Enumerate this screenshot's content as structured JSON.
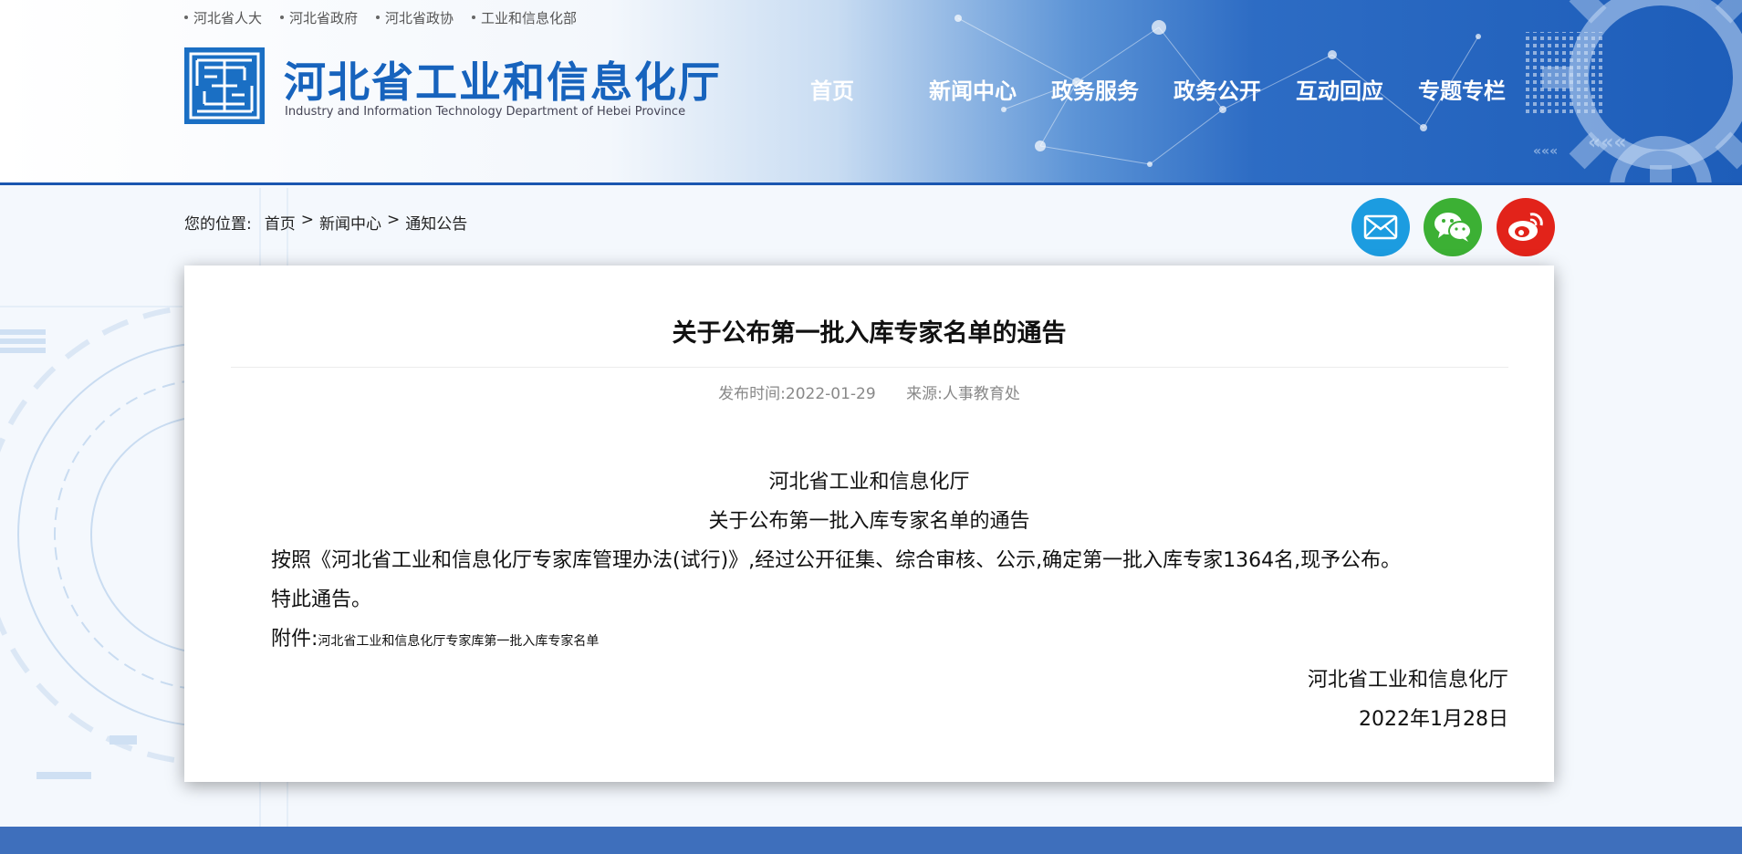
{
  "top_links": [
    "河北省人大",
    "河北省政府",
    "河北省政协",
    "工业和信息化部"
  ],
  "site": {
    "title": "河北省工业和信息化厅",
    "subtitle": "Industry and Information Technology Department of Hebei Province"
  },
  "nav": [
    "首页",
    "新闻中心",
    "政务服务",
    "政务公开",
    "互动回应",
    "专题专栏"
  ],
  "breadcrumb": {
    "prefix": "您的位置:",
    "items": [
      "首页",
      "新闻中心",
      "通知公告"
    ],
    "separator": ">"
  },
  "share": [
    {
      "name": "email",
      "color": "#1c9ce0"
    },
    {
      "name": "wechat",
      "color": "#3cb034"
    },
    {
      "name": "weibo",
      "color": "#e2231a"
    }
  ],
  "article": {
    "title": "关于公布第一批入库专家名单的通告",
    "publish_time": "发布时间:2022-01-29",
    "source": "来源:人事教育处",
    "org_line": "河北省工业和信息化厅",
    "heading_line": "关于公布第一批入库专家名单的通告",
    "paragraph": "按照《河北省工业和信息化厅专家库管理办法(试行)》,经过公开征集、综合审核、公示,确定第一批入库专家1364名,现予公布。",
    "notice": "特此通告。",
    "attachment_label": "附件:",
    "attachment_link": "河北省工业和信息化厅专家库第一批入库专家名单",
    "signature": "河北省工业和信息化厅",
    "date": "2022年1月28日"
  },
  "colors": {
    "brand_blue": "#1763bd",
    "footer_blue": "#3e6fbc"
  }
}
